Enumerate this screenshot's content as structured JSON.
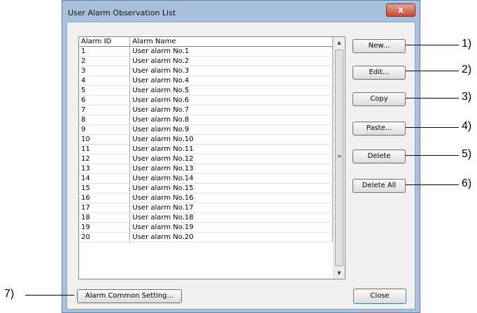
{
  "dialog": {
    "title": "User Alarm Observation List",
    "close_glyph": "x"
  },
  "table": {
    "headers": [
      "Alarm ID",
      "Alarm Name"
    ],
    "rows": [
      [
        "1",
        "User alarm No.1"
      ],
      [
        "2",
        "User alarm No.2"
      ],
      [
        "3",
        "User alarm No.3"
      ],
      [
        "4",
        "User alarm No.4"
      ],
      [
        "5",
        "User alarm No.5"
      ],
      [
        "6",
        "User alarm No.6"
      ],
      [
        "7",
        "User alarm No.7"
      ],
      [
        "8",
        "User alarm No.8"
      ],
      [
        "9",
        "User alarm No.9"
      ],
      [
        "10",
        "User alarm No.10"
      ],
      [
        "11",
        "User alarm No.11"
      ],
      [
        "12",
        "User alarm No.12"
      ],
      [
        "13",
        "User alarm No.13"
      ],
      [
        "14",
        "User alarm No.14"
      ],
      [
        "15",
        "User alarm No.15"
      ],
      [
        "16",
        "User alarm No.16"
      ],
      [
        "17",
        "User alarm No.17"
      ],
      [
        "18",
        "User alarm No.18"
      ],
      [
        "19",
        "User alarm No.19"
      ],
      [
        "20",
        "User alarm No.20"
      ]
    ]
  },
  "buttons": {
    "new": "New...",
    "edit": "Edit...",
    "copy": "Copy",
    "paste": "Paste...",
    "delete": "Delete",
    "delete_all": "Delete All",
    "alarm_common_setting": "Alarm Common Setting...",
    "close": "Close"
  },
  "callouts": [
    "1)",
    "2)",
    "3)",
    "4)",
    "5)",
    "6)",
    "7)"
  ],
  "scrollbar": {
    "up_glyph": "▲",
    "down_glyph": "▼",
    "grip_glyph": "≡"
  }
}
